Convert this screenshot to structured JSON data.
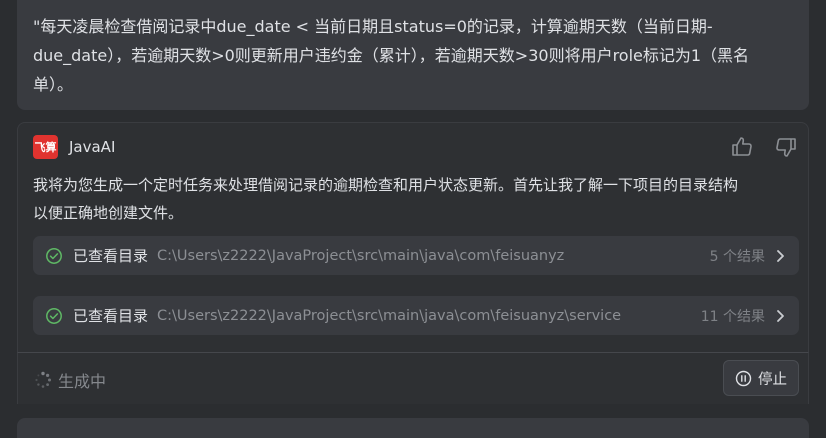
{
  "user_message": {
    "line1": "\"每天凌晨检查借阅记录中due_date < 当前日期且status=0的记录，计算逾期天数（当前日期-",
    "line2": "due_date），若逾期天数>0则更新用户违约金（累计），若逾期天数>30则将用户role标记为1（黑名",
    "line3": "单）。"
  },
  "assistant": {
    "logo_text": "飞算",
    "name": "JavaAI",
    "message_line1": "我将为您生成一个定时任务来处理借阅记录的逾期检查和用户状态更新。首先让我了解一下项目的目录结构",
    "message_line2": "以便正确地创建文件。",
    "tool_calls": [
      {
        "label": "已查看目录",
        "path": "C:\\Users\\z2222\\JavaProject\\src\\main\\java\\com\\feisuanyz",
        "result": "5 个结果"
      },
      {
        "label": "已查看目录",
        "path": "C:\\Users\\z2222\\JavaProject\\src\\main\\java\\com\\feisuanyz\\service",
        "result": "11 个结果"
      }
    ]
  },
  "status_bar": {
    "generating_label": "生成中",
    "stop_label": "停止"
  },
  "colors": {
    "background": "#2b2d30",
    "card": "#393b40",
    "logo_red": "#e0332f",
    "success_green": "#5fb865"
  },
  "icons": [
    "thumbs-up-icon",
    "thumbs-down-icon",
    "check-circle-icon",
    "chevron-right-icon",
    "spinner-icon",
    "stop-icon"
  ]
}
